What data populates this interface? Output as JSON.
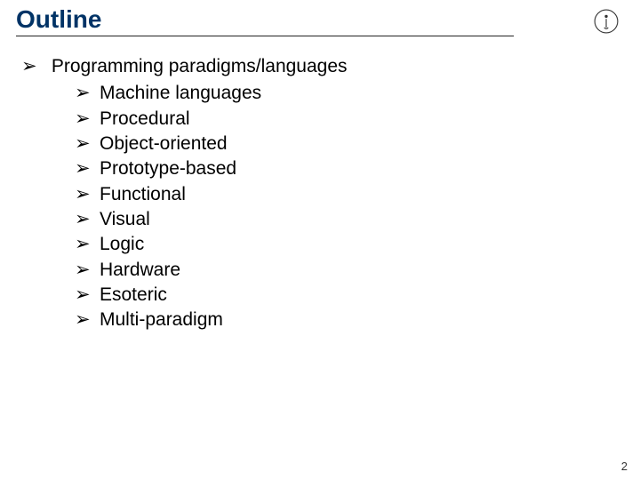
{
  "title": "Outline",
  "main_item": "Programming paradigms/languages",
  "sub_items": [
    "Machine languages",
    "Procedural",
    "Object-oriented",
    "Prototype-based",
    "Functional",
    "Visual",
    "Logic",
    "Hardware",
    "Esoteric",
    "Multi-paradigm"
  ],
  "page_number": "2"
}
